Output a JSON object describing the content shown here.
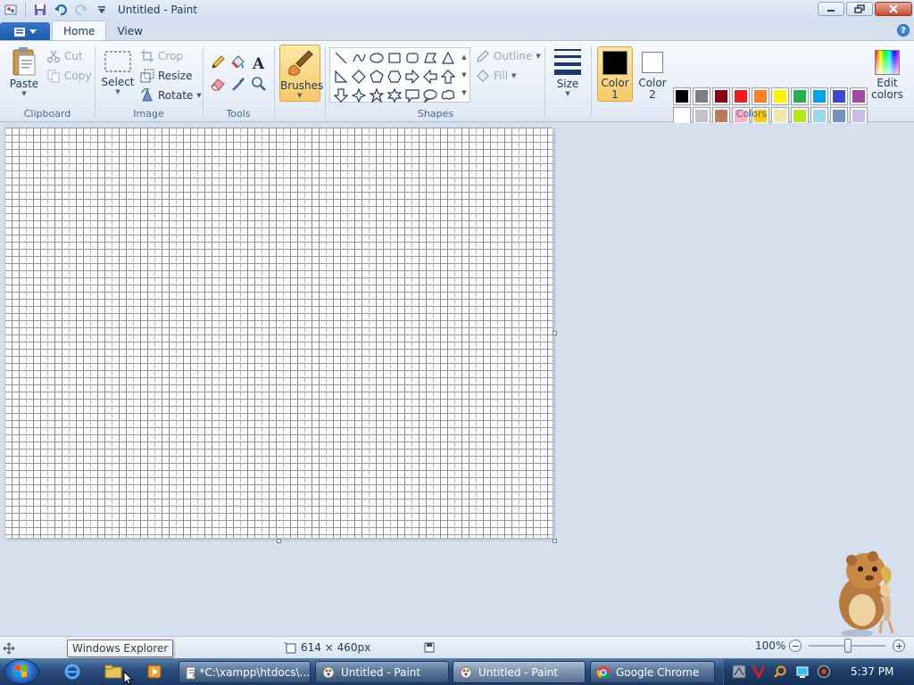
{
  "window": {
    "title": "Untitled - Paint"
  },
  "tabs": [
    {
      "label": "Home",
      "active": true
    },
    {
      "label": "View",
      "active": false
    }
  ],
  "ribbon": {
    "clipboard": {
      "label": "Clipboard",
      "paste": "Paste",
      "cut": "Cut",
      "copy": "Copy"
    },
    "image": {
      "label": "Image",
      "select": "Select",
      "crop": "Crop",
      "resize": "Resize",
      "rotate": "Rotate"
    },
    "tools": {
      "label": "Tools",
      "items": [
        "pencil-icon",
        "fill-icon",
        "text-icon",
        "eraser-icon",
        "color-picker-icon",
        "magnifier-icon"
      ]
    },
    "brushes": {
      "label": "Brushes"
    },
    "shapes": {
      "label": "Shapes",
      "outline": "Outline",
      "fill": "Fill"
    },
    "size": {
      "label": "Size"
    },
    "colors": {
      "label": "Colors",
      "color1_line1": "Color",
      "color1_line2": "1",
      "color2_line1": "Color",
      "color2_line2": "2",
      "edit_line1": "Edit",
      "edit_line2": "colors",
      "color1": "#000000",
      "color2": "#ffffff",
      "palette": [
        "#000000",
        "#7f7f7f",
        "#880015",
        "#ed1c24",
        "#ff7f27",
        "#fff200",
        "#22b14c",
        "#00a2e8",
        "#3f48cc",
        "#a349a4",
        "#ffffff",
        "#c3c3c3",
        "#b97a57",
        "#ffaec9",
        "#ffc90e",
        "#efe4b0",
        "#b5e61d",
        "#99d9ea",
        "#7092be",
        "#c8bfe7"
      ]
    }
  },
  "status": {
    "tooltip": "Windows Explorer",
    "canvas_size": "614 × 460px",
    "zoom": "100%"
  },
  "taskbar": {
    "tasks": [
      {
        "label": "*C:\\xampp\\htdocs\\..."
      },
      {
        "label": "Untitled - Paint"
      },
      {
        "label": "Untitled - Paint"
      },
      {
        "label": "Google Chrome"
      }
    ],
    "clock": "5:37 PM"
  }
}
